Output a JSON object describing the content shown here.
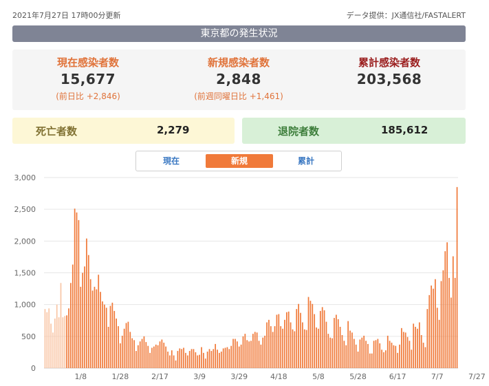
{
  "header": {
    "updated": "2021年7月27日 17時00分更新",
    "source": "データ提供：JX通信社/FASTALERT"
  },
  "title": "東京都の発生状況",
  "stats": {
    "current": {
      "label": "現在感染者数",
      "value": "15,677",
      "sub": "(前日比 +2,846)"
    },
    "new": {
      "label": "新規感染者数",
      "value": "2,848",
      "sub": "(前週同曜日比 +1,461)"
    },
    "total": {
      "label": "累計感染者数",
      "value": "203,568"
    }
  },
  "deaths": {
    "label": "死亡者数",
    "value": "2,279"
  },
  "discharged": {
    "label": "退院者数",
    "value": "185,612"
  },
  "tabs": [
    {
      "label": "現在",
      "active": false
    },
    {
      "label": "新規",
      "active": true
    },
    {
      "label": "累計",
      "active": false
    }
  ],
  "colors": {
    "bar": "#f07a3a",
    "bar_faded": "#f9c6a6",
    "grid": "#e6e6e6",
    "tab_active": "#f07a3a",
    "tab_text": "#3a78c2"
  },
  "chart_data": {
    "type": "bar",
    "ylim": [
      0,
      3000
    ],
    "yticks": [
      "0",
      "500",
      "1,000",
      "1,500",
      "2,000",
      "2,500",
      "3,000"
    ],
    "ytick_values": [
      0,
      500,
      1000,
      1500,
      2000,
      2500,
      3000
    ],
    "xticks": [
      {
        "label": "1/8",
        "index": 18
      },
      {
        "label": "1/28",
        "index": 38
      },
      {
        "label": "2/17",
        "index": 58
      },
      {
        "label": "3/9",
        "index": 78
      },
      {
        "label": "3/29",
        "index": 98
      },
      {
        "label": "4/18",
        "index": 118
      },
      {
        "label": "5/8",
        "index": 138
      },
      {
        "label": "5/28",
        "index": 158
      },
      {
        "label": "6/17",
        "index": 178
      },
      {
        "label": "7/7",
        "index": 198
      },
      {
        "label": "7/27",
        "index": 218
      }
    ],
    "faded_count": 11,
    "values": [
      930,
      880,
      940,
      700,
      560,
      780,
      1000,
      800,
      1340,
      800,
      820,
      830,
      940,
      1340,
      1630,
      2510,
      2450,
      2330,
      1280,
      1500,
      1600,
      2040,
      1780,
      1400,
      1220,
      1280,
      1240,
      1470,
      1200,
      1050,
      1000,
      950,
      650,
      980,
      1030,
      900,
      780,
      660,
      390,
      510,
      620,
      710,
      730,
      570,
      470,
      440,
      270,
      360,
      420,
      460,
      500,
      410,
      350,
      240,
      320,
      340,
      370,
      360,
      420,
      450,
      400,
      340,
      260,
      200,
      280,
      200,
      120,
      270,
      310,
      300,
      320,
      240,
      200,
      270,
      300,
      300,
      250,
      200,
      210,
      330,
      240,
      150,
      260,
      300,
      270,
      300,
      380,
      290,
      240,
      260,
      310,
      320,
      330,
      300,
      350,
      460,
      460,
      420,
      340,
      370,
      500,
      540,
      440,
      420,
      430,
      540,
      570,
      560,
      430,
      370,
      480,
      510,
      720,
      760,
      660,
      570,
      660,
      840,
      850,
      660,
      620,
      760,
      880,
      890,
      720,
      610,
      580,
      930,
      1010,
      870,
      720,
      610,
      600,
      1120,
      1060,
      1010,
      850,
      640,
      620,
      900,
      960,
      910,
      730,
      540,
      480,
      470,
      790,
      840,
      770,
      650,
      520,
      430,
      360,
      740,
      590,
      560,
      460,
      370,
      260,
      450,
      480,
      510,
      430,
      380,
      230,
      230,
      430,
      440,
      460,
      390,
      290,
      250,
      280,
      510,
      430,
      400,
      360,
      350,
      240,
      370,
      630,
      570,
      560,
      490,
      430,
      290,
      700,
      650,
      620,
      720,
      520,
      400,
      330,
      930,
      1150,
      1300,
      1250,
      1400,
      950,
      760,
      1370,
      1540,
      1840,
      1980,
      1420,
      1110,
      1760,
      1420,
      2850
    ]
  }
}
